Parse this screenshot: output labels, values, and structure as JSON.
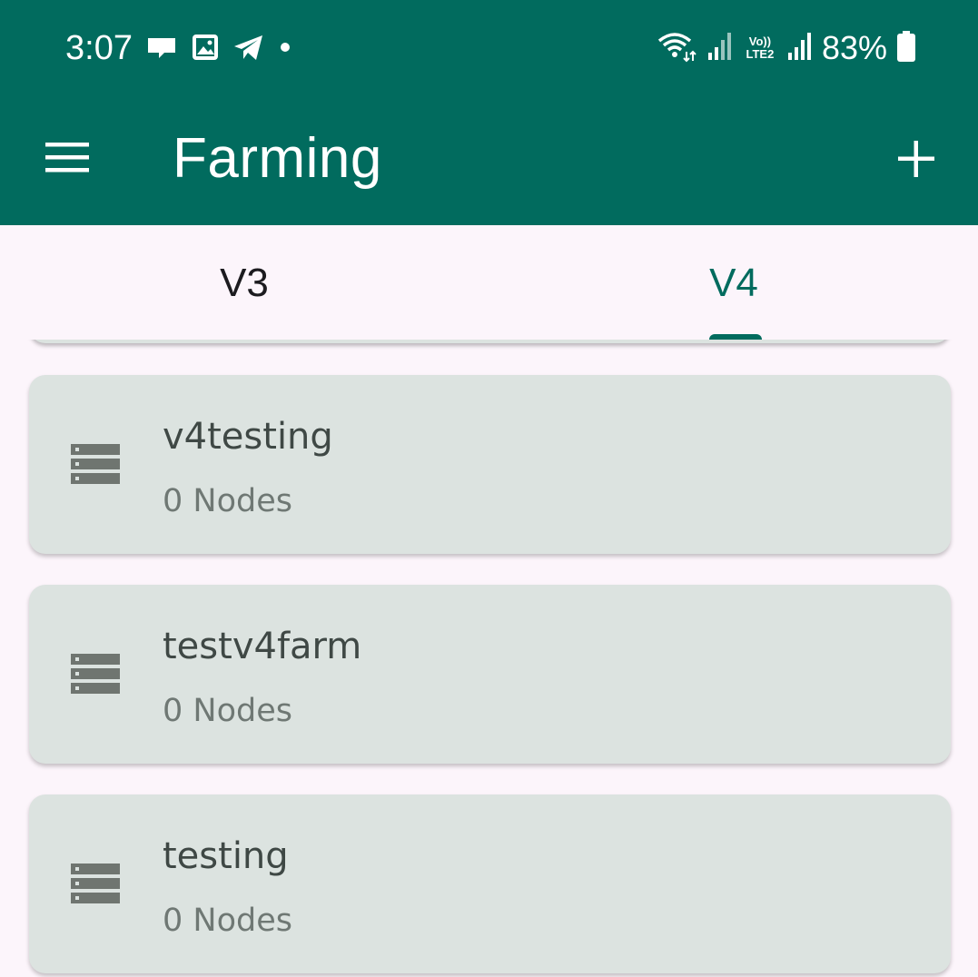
{
  "status_bar": {
    "time": "3:07",
    "left_icons": [
      "message-icon",
      "image-icon",
      "telegram-icon",
      "dot-icon"
    ],
    "right_icons": [
      "wifi-icon",
      "signal-icon",
      "volte-icon",
      "signal-icon",
      "battery-icon"
    ],
    "volte_label": "Vo))",
    "lte_label": "LTE2",
    "battery_percent": "83%"
  },
  "app_bar": {
    "title": "Farming",
    "menu_icon": "hamburger-menu-icon",
    "add_icon": "plus-icon"
  },
  "tabs": [
    {
      "label": "V3",
      "selected": false
    },
    {
      "label": "V4",
      "selected": true
    }
  ],
  "farms": [
    {
      "name": "v4testing",
      "nodes": "0 Nodes",
      "icon": "server-icon"
    },
    {
      "name": "testv4farm",
      "nodes": "0 Nodes",
      "icon": "server-icon"
    },
    {
      "name": "testing",
      "nodes": "0 Nodes",
      "icon": "server-icon"
    }
  ],
  "colors": {
    "primary": "#016b5e",
    "background": "#fcf5fb",
    "card": "#dce3e0",
    "card_title": "#3f4845",
    "card_subtitle": "#6f7874"
  }
}
